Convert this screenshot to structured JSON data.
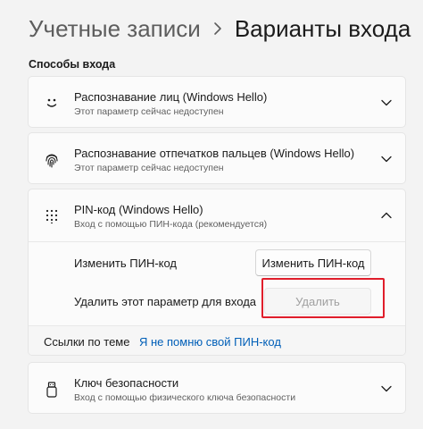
{
  "breadcrumb": {
    "parent": "Учетные записи",
    "separator_icon": "chevron-right-icon",
    "current": "Варианты входа"
  },
  "section_title": "Способы входа",
  "options": {
    "face": {
      "icon": "face-icon",
      "title": "Распознавание лиц (Windows Hello)",
      "subtitle": "Этот параметр сейчас недоступен",
      "expanded": false
    },
    "fingerprint": {
      "icon": "fingerprint-icon",
      "title": "Распознавание отпечатков пальцев (Windows Hello)",
      "subtitle": "Этот параметр сейчас недоступен",
      "expanded": false
    },
    "pin": {
      "icon": "pin-keypad-icon",
      "title": "PIN-код (Windows Hello)",
      "subtitle": "Вход с помощью ПИН-кода (рекомендуется)",
      "expanded": true,
      "change_label": "Изменить ПИН-код",
      "change_button": "Изменить ПИН-код",
      "remove_label": "Удалить этот параметр для входа",
      "remove_button": "Удалить",
      "remove_button_enabled": false,
      "related_label": "Ссылки по теме",
      "related_link": "Я не помню свой ПИН-код"
    },
    "security_key": {
      "icon": "usb-key-icon",
      "title": "Ключ безопасности",
      "subtitle": "Вход с помощью физического ключа безопасности",
      "expanded": false
    }
  },
  "colors": {
    "accent_link": "#005fb8",
    "highlight_box": "#e01e2b",
    "background": "#f3f3f3",
    "card": "#fbfbfb"
  }
}
